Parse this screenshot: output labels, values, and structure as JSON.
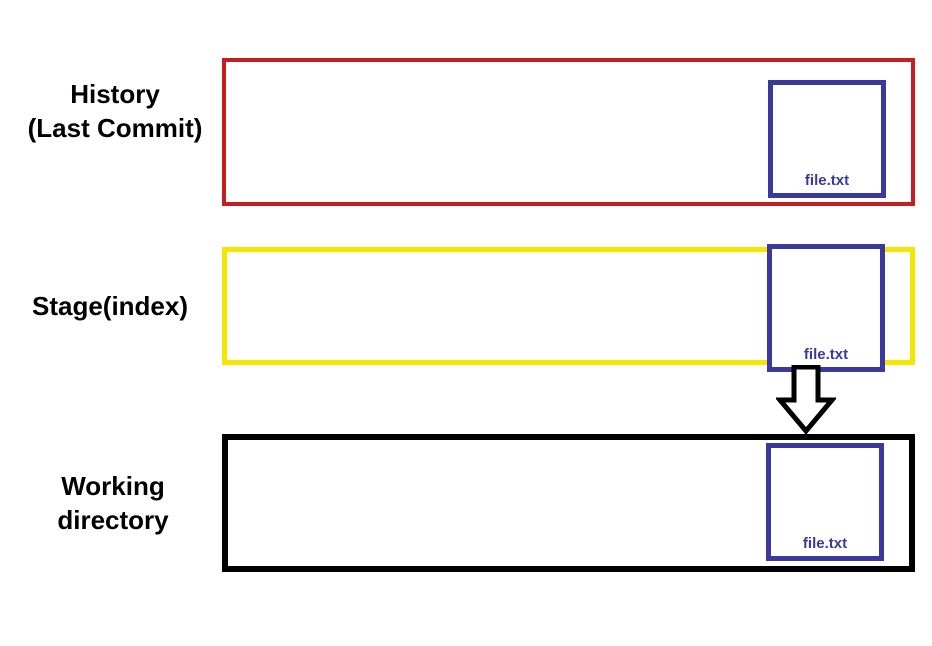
{
  "labels": {
    "history_line1": "History",
    "history_line2": "(Last Commit)",
    "stage": "Stage(index)",
    "working_line1": "Working",
    "working_line2": "directory"
  },
  "zones": {
    "history": {
      "border_color": "#c41e1e",
      "file_label": "file.txt"
    },
    "stage": {
      "border_color": "#f5e600",
      "file_label": "file.txt"
    },
    "working": {
      "border_color": "#000000",
      "file_label": "file.txt"
    }
  },
  "file_box_color": "#3a3a9e",
  "arrow_direction": "down"
}
